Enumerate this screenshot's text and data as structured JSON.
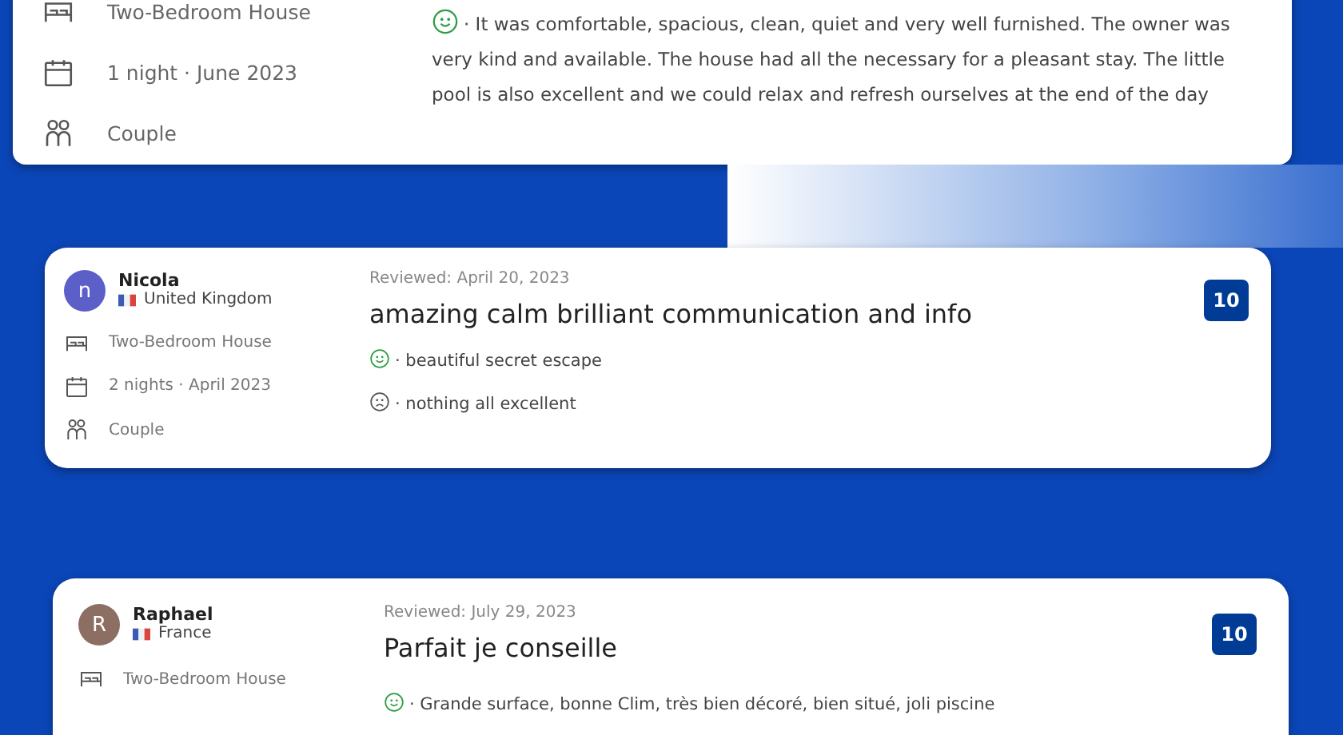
{
  "reviews": [
    {
      "details": [
        {
          "kind": "room",
          "text": "Two-Bedroom House"
        },
        {
          "kind": "stay",
          "text": "1 night ·  June 2023"
        },
        {
          "kind": "group",
          "text": "Couple"
        }
      ],
      "comments": [
        {
          "kind": "positive",
          "text": "· It was comfortable, spacious, clean, quiet and very well furnished. The owner was very kind and available. The house had all the necessary for a pleasant stay. The little pool is also excellent and we could relax and refresh ourselves at the end of the day"
        }
      ]
    },
    {
      "initial": "n",
      "color": "#5b5fc7",
      "name": "Nicola",
      "country": "United Kingdom",
      "reviewed": "Reviewed: April 20, 2023",
      "title": "amazing calm brilliant communication and info",
      "score": "10",
      "details": [
        {
          "kind": "room",
          "text": "Two-Bedroom House"
        },
        {
          "kind": "stay",
          "text": "2 nights · April 2023"
        },
        {
          "kind": "group",
          "text": "Couple"
        }
      ],
      "comments": [
        {
          "kind": "positive",
          "text": "· beautiful secret escape"
        },
        {
          "kind": "negative",
          "text": "· nothing all excellent"
        }
      ]
    },
    {
      "initial": "R",
      "color": "#8d6e63",
      "name": "Raphael",
      "country": "France",
      "reviewed": "Reviewed: July 29, 2023",
      "title": "Parfait je conseille",
      "score": "10",
      "details": [
        {
          "kind": "room",
          "text": "Two-Bedroom House"
        }
      ],
      "comments": [
        {
          "kind": "positive",
          "text": "· Grande surface, bonne Clim, très bien décoré, bien situé, joli piscine"
        }
      ]
    }
  ]
}
